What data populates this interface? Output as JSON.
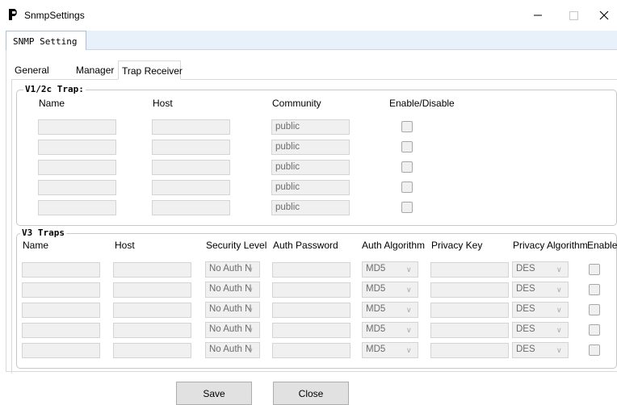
{
  "window": {
    "title": "SnmpSettings",
    "minimize_glyph": "—",
    "maximize_glyph": "☐",
    "close_glyph": "✕"
  },
  "outer_tab": {
    "label": "SNMP Setting"
  },
  "inner_tabs": [
    {
      "label": "General"
    },
    {
      "label": "Manager"
    },
    {
      "label": "Trap Receiver",
      "active": true
    }
  ],
  "v1v2c": {
    "legend": "V1/2c Trap:",
    "headers": {
      "name": "Name",
      "host": "Host",
      "community": "Community",
      "enable": "Enable/Disable"
    },
    "rows": [
      {
        "name": "",
        "host": "",
        "community": "public",
        "enabled": false
      },
      {
        "name": "",
        "host": "",
        "community": "public",
        "enabled": false
      },
      {
        "name": "",
        "host": "",
        "community": "public",
        "enabled": false
      },
      {
        "name": "",
        "host": "",
        "community": "public",
        "enabled": false
      },
      {
        "name": "",
        "host": "",
        "community": "public",
        "enabled": false
      }
    ]
  },
  "v3": {
    "legend": "V3 Traps",
    "headers": {
      "name": "Name",
      "host": "Host",
      "security_level": "Security Level",
      "auth_password": "Auth Password",
      "auth_algorithm": "Auth Algorithm",
      "privacy_key": "Privacy Key",
      "privacy_algorithm": "Privacy Algorithm",
      "enable": "Enable"
    },
    "rows": [
      {
        "name": "",
        "host": "",
        "security_level": "No Auth N",
        "auth_password": "",
        "auth_algorithm": "MD5",
        "privacy_key": "",
        "privacy_algorithm": "DES",
        "enabled": false
      },
      {
        "name": "",
        "host": "",
        "security_level": "No Auth N",
        "auth_password": "",
        "auth_algorithm": "MD5",
        "privacy_key": "",
        "privacy_algorithm": "DES",
        "enabled": false
      },
      {
        "name": "",
        "host": "",
        "security_level": "No Auth N",
        "auth_password": "",
        "auth_algorithm": "MD5",
        "privacy_key": "",
        "privacy_algorithm": "DES",
        "enabled": false
      },
      {
        "name": "",
        "host": "",
        "security_level": "No Auth N",
        "auth_password": "",
        "auth_algorithm": "MD5",
        "privacy_key": "",
        "privacy_algorithm": "DES",
        "enabled": false
      },
      {
        "name": "",
        "host": "",
        "security_level": "No Auth N",
        "auth_password": "",
        "auth_algorithm": "MD5",
        "privacy_key": "",
        "privacy_algorithm": "DES",
        "enabled": false
      }
    ]
  },
  "buttons": {
    "save": "Save",
    "close": "Close"
  },
  "icons": {
    "app": "app-logo-icon",
    "chevron": "chevron-down-icon"
  }
}
